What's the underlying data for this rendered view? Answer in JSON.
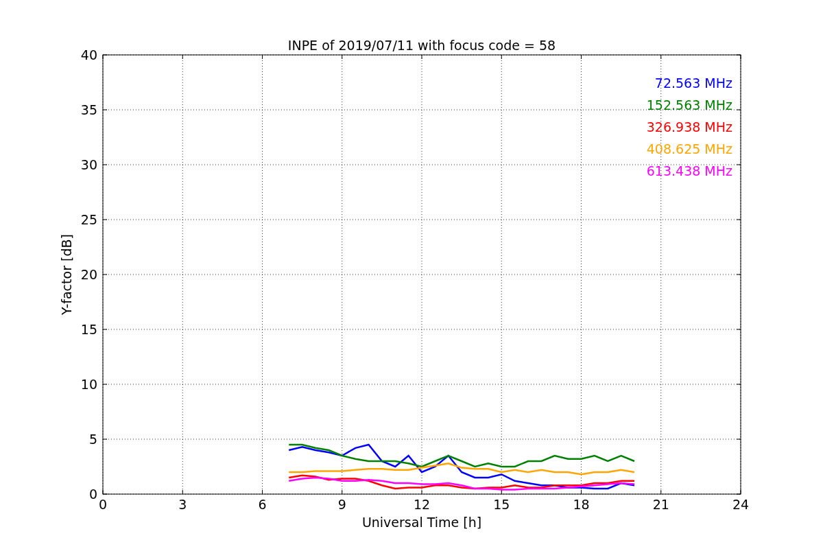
{
  "chart_data": {
    "type": "line",
    "title": "INPE of 2019/07/11 with focus code = 58",
    "xlabel": "Universal Time [h]",
    "ylabel": "Y-factor [dB]",
    "x": [
      7,
      7.5,
      8,
      8.5,
      9,
      9.5,
      10,
      10.5,
      11,
      11.5,
      12,
      12.5,
      13,
      13.5,
      14,
      14.5,
      15,
      15.5,
      16,
      16.5,
      17,
      17.5,
      18,
      18.5,
      19,
      19.5,
      20
    ],
    "series": [
      {
        "name": "72.563 MHz",
        "color": "#0000ff",
        "values": [
          4.0,
          4.3,
          4.0,
          3.8,
          3.5,
          4.2,
          4.5,
          3.0,
          2.5,
          3.5,
          2.0,
          2.5,
          3.5,
          2.0,
          1.5,
          1.5,
          1.8,
          1.2,
          1.0,
          0.8,
          0.8,
          0.6,
          0.6,
          0.5,
          0.5,
          1.0,
          0.8
        ]
      },
      {
        "name": "152.563 MHz",
        "color": "#008000",
        "values": [
          4.5,
          4.5,
          4.2,
          4.0,
          3.5,
          3.2,
          3.0,
          3.0,
          3.0,
          2.8,
          2.5,
          3.0,
          3.5,
          3.0,
          2.5,
          2.8,
          2.5,
          2.5,
          3.0,
          3.0,
          3.5,
          3.2,
          3.2,
          3.5,
          3.0,
          3.5,
          3.0
        ]
      },
      {
        "name": "326.938 MHz",
        "color": "#ff0000",
        "values": [
          1.5,
          1.7,
          1.6,
          1.3,
          1.4,
          1.4,
          1.2,
          0.8,
          0.5,
          0.6,
          0.6,
          0.8,
          0.8,
          0.6,
          0.5,
          0.6,
          0.6,
          0.8,
          0.6,
          0.6,
          0.8,
          0.8,
          0.8,
          1.0,
          1.0,
          1.2,
          1.2
        ]
      },
      {
        "name": "408.625 MHz",
        "color": "#ffa500",
        "values": [
          2.0,
          2.0,
          2.1,
          2.1,
          2.1,
          2.2,
          2.3,
          2.3,
          2.2,
          2.2,
          2.4,
          2.6,
          2.8,
          2.4,
          2.3,
          2.3,
          2.0,
          2.2,
          2.0,
          2.2,
          2.0,
          2.0,
          1.8,
          2.0,
          2.0,
          2.2,
          2.0
        ]
      },
      {
        "name": "613.438 MHz",
        "color": "#ff00ff",
        "values": [
          1.2,
          1.4,
          1.5,
          1.4,
          1.2,
          1.2,
          1.3,
          1.2,
          1.0,
          1.0,
          0.9,
          0.9,
          1.0,
          0.8,
          0.5,
          0.5,
          0.4,
          0.4,
          0.5,
          0.5,
          0.5,
          0.6,
          0.7,
          0.8,
          0.9,
          1.0,
          0.9
        ]
      }
    ],
    "grid": true,
    "xlim": [
      0,
      24
    ],
    "ylim": [
      0,
      40
    ],
    "xticks": [
      0,
      3,
      6,
      9,
      12,
      15,
      18,
      21,
      24
    ],
    "yticks": [
      0,
      5,
      10,
      15,
      20,
      25,
      30,
      35,
      40
    ]
  }
}
